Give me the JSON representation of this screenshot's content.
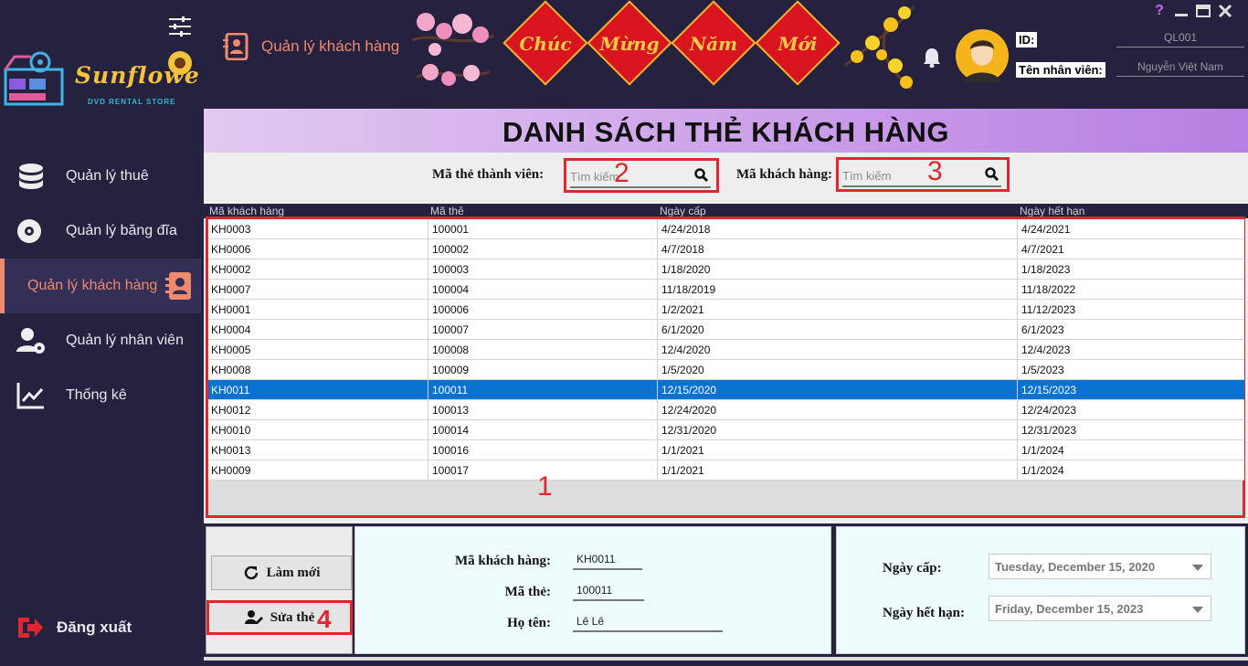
{
  "sidebar": {
    "logo_text": "Sunflower",
    "logo_sub": "DVD RENTAL STORE",
    "items": [
      {
        "label": "Quản lý thuê",
        "icon": "database-icon"
      },
      {
        "label": "Quản lý băng đĩa",
        "icon": "disc-icon"
      },
      {
        "label": "Quản lý khách hàng",
        "icon": "contact-card-icon"
      },
      {
        "label": "Quản lý nhân viên",
        "icon": "user-gear-icon"
      },
      {
        "label": "Thống kê",
        "icon": "chart-line-icon"
      }
    ],
    "active_index": 2,
    "logout_label": "Đăng xuất"
  },
  "topbar": {
    "page_title": "Quản lý khách hàng",
    "banner_words": [
      "Chúc",
      "Mừng",
      "Năm",
      "Mới"
    ],
    "id_label": "ID:",
    "id_value": "QL001",
    "name_label": "Tên nhân viên:",
    "name_value": "Nguyễn Việt Nam",
    "help_icon": "?"
  },
  "main": {
    "heading": "DANH SÁCH THẺ KHÁCH HÀNG",
    "search_card_label": "Mã thẻ thành viên:",
    "search_card_placeholder": "Tìm kiếm",
    "search_customer_label": "Mã khách hàng:",
    "search_customer_placeholder": "Tìm kiếm",
    "columns": [
      "Mã khách hàng",
      "Mã thẻ",
      "Ngày cấp",
      "Ngày hết hạn"
    ],
    "rows": [
      [
        "KH0003",
        "100001",
        "4/24/2018",
        "4/24/2021"
      ],
      [
        "KH0006",
        "100002",
        "4/7/2018",
        "4/7/2021"
      ],
      [
        "KH0002",
        "100003",
        "1/18/2020",
        "1/18/2023"
      ],
      [
        "KH0007",
        "100004",
        "11/18/2019",
        "11/18/2022"
      ],
      [
        "KH0001",
        "100006",
        "1/2/2021",
        "11/12/2023"
      ],
      [
        "KH0004",
        "100007",
        "6/1/2020",
        "6/1/2023"
      ],
      [
        "KH0005",
        "100008",
        "12/4/2020",
        "12/4/2023"
      ],
      [
        "KH0008",
        "100009",
        "1/5/2020",
        "1/5/2023"
      ],
      [
        "KH0011",
        "100011",
        "12/15/2020",
        "12/15/2023"
      ],
      [
        "KH0012",
        "100013",
        "12/24/2020",
        "12/24/2023"
      ],
      [
        "KH0010",
        "100014",
        "12/31/2020",
        "12/31/2023"
      ],
      [
        "KH0013",
        "100016",
        "1/1/2021",
        "1/1/2024"
      ],
      [
        "KH0009",
        "100017",
        "1/1/2021",
        "1/1/2024"
      ]
    ],
    "selected_row": 8,
    "annotations": [
      "1",
      "2",
      "3",
      "4"
    ]
  },
  "actions": {
    "refresh_label": "Làm mới",
    "edit_label": "Sửa thẻ"
  },
  "details": {
    "customer_id_label": "Mã khách hàng:",
    "customer_id_value": "KH0011",
    "card_id_label": "Mã thẻ:",
    "card_id_value": "100011",
    "name_label": "Họ tên:",
    "name_value": "Lê Lê",
    "issue_date_label": "Ngày cấp:",
    "issue_date_value": "Tuesday, December 15, 2020",
    "expiry_date_label": "Ngày hết hạn:",
    "expiry_date_value": "Friday, December 15, 2023"
  }
}
